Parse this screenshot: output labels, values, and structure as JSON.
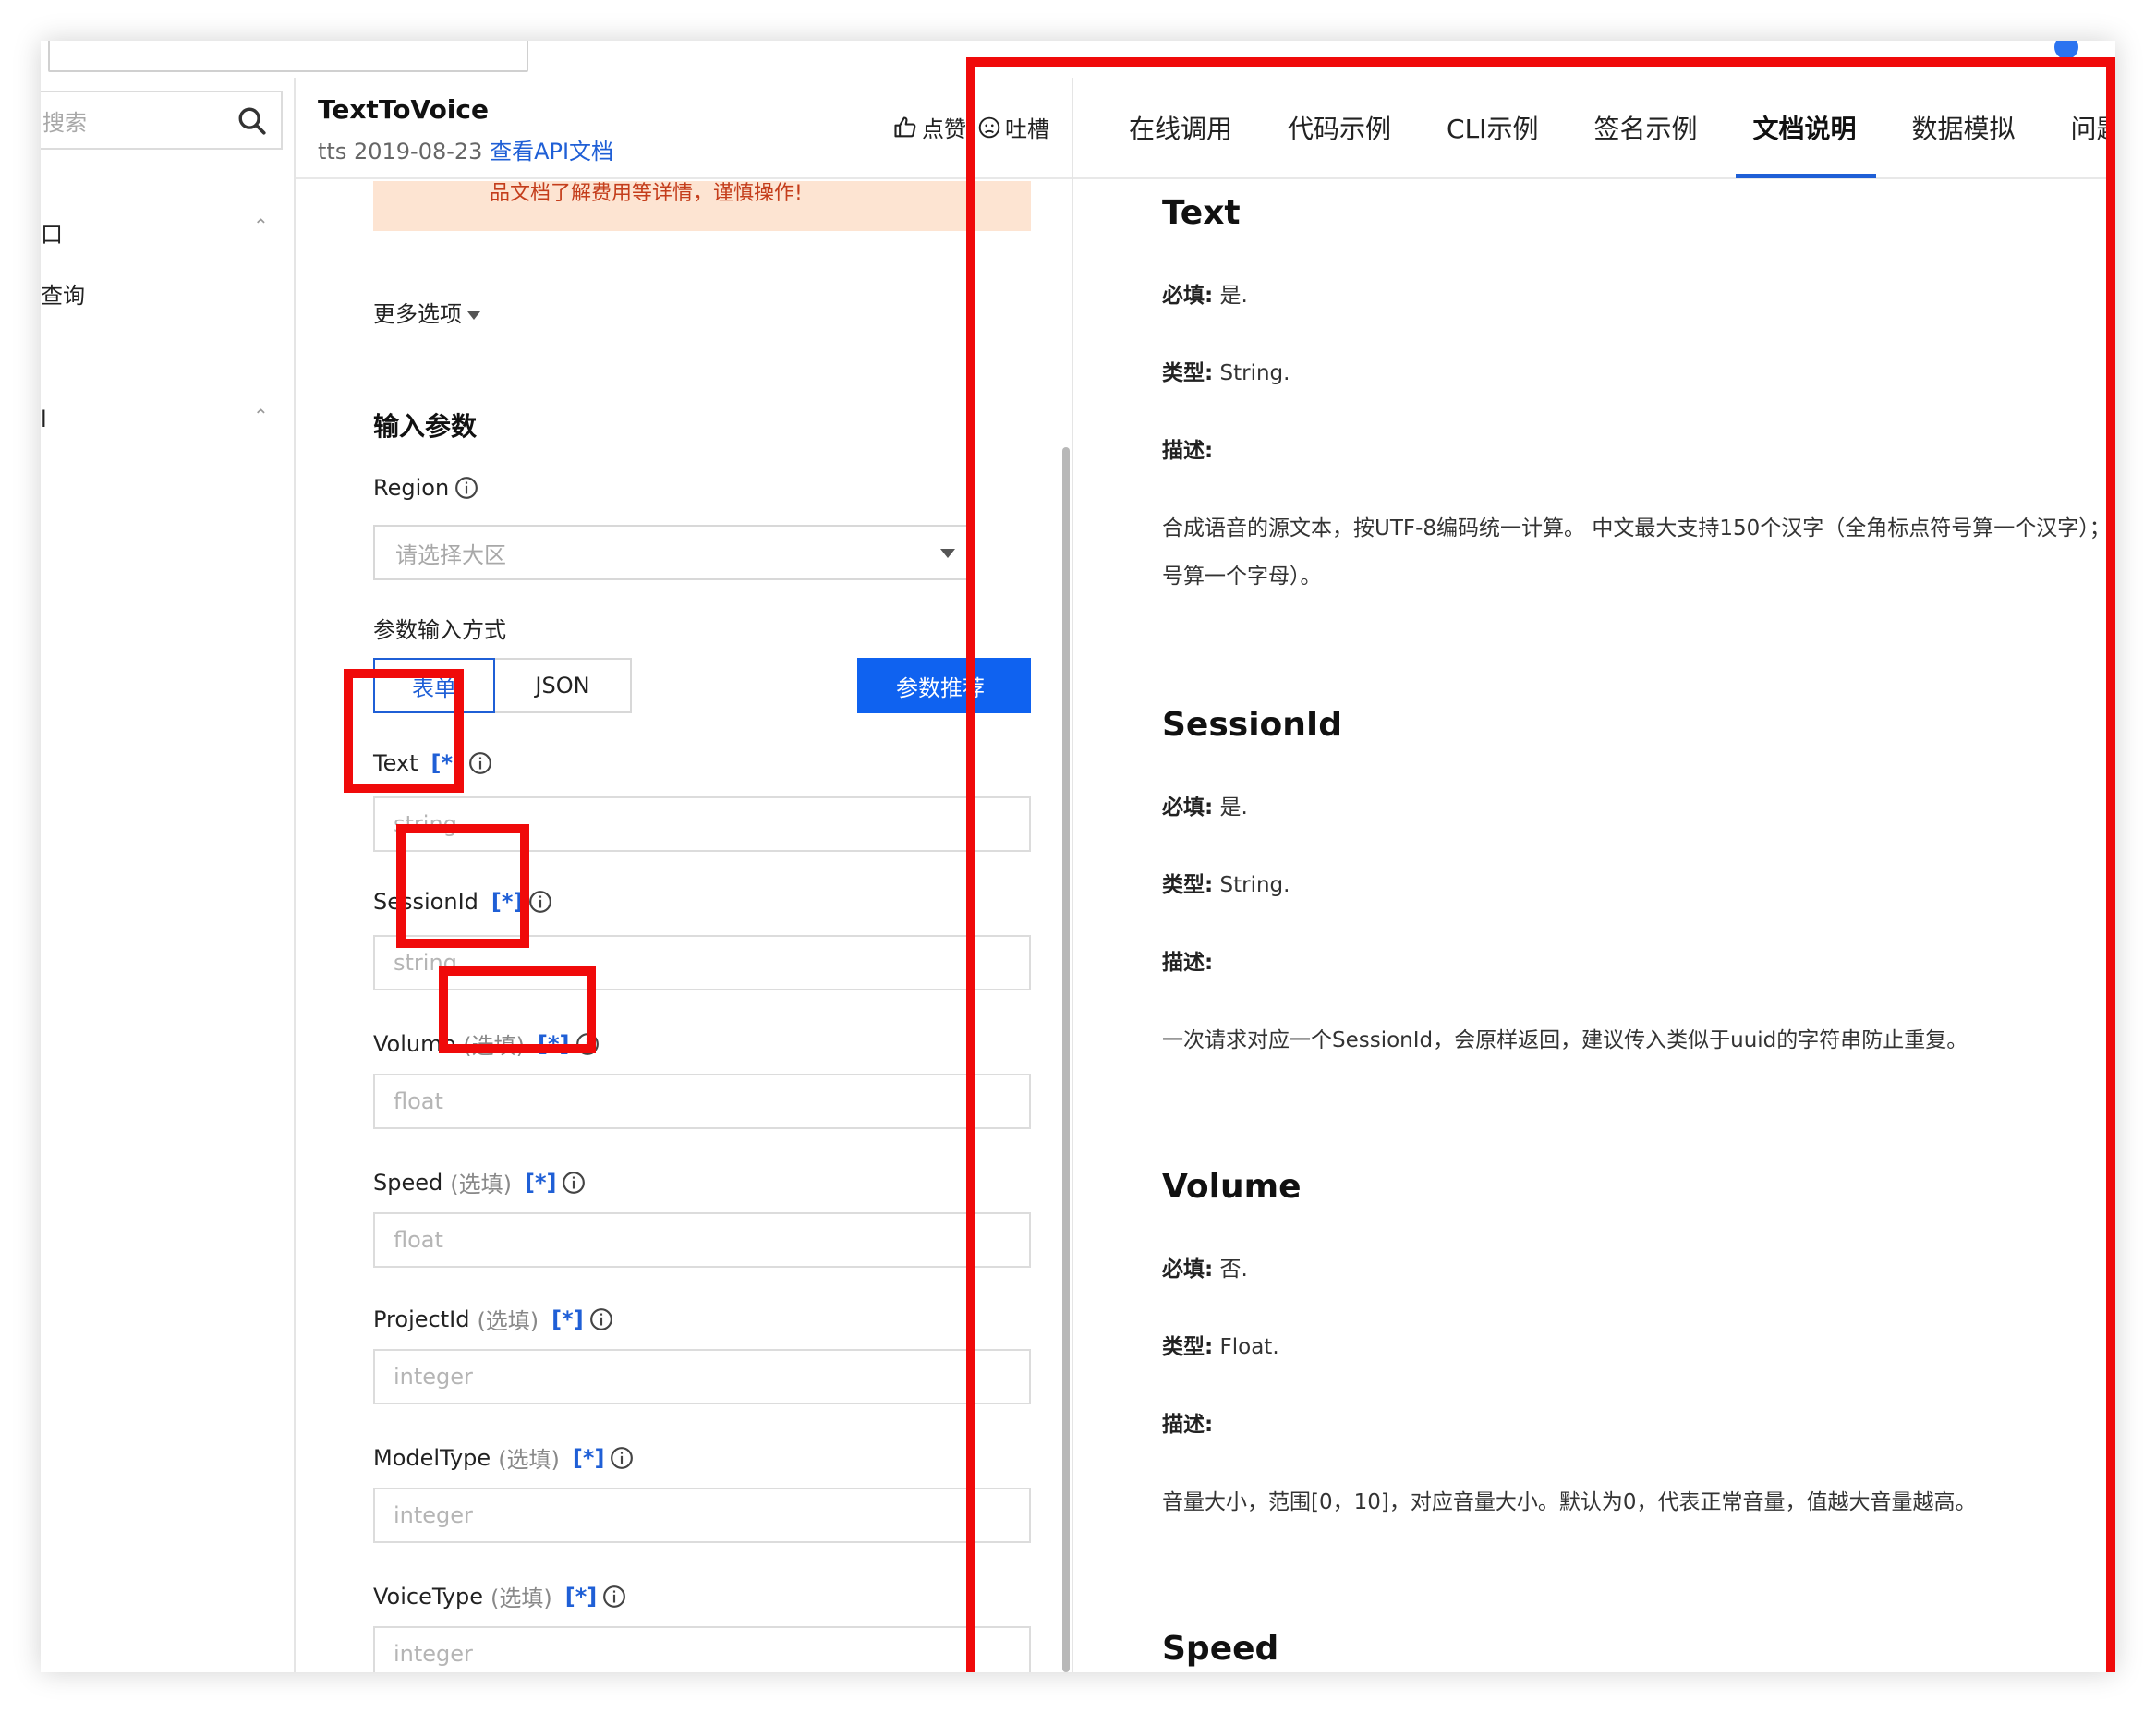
{
  "header": {
    "api_name": "TextToVoice",
    "api_meta": "tts 2019-08-23",
    "api_doc_link": "查看API文档",
    "like_label": "点赞",
    "complain_label": "吐槽"
  },
  "sidebar": {
    "search_placeholder": "搜索",
    "items": [
      {
        "label": "口"
      },
      {
        "label": "查询"
      },
      {
        "label": "l"
      }
    ]
  },
  "form": {
    "warning_text": "品文档了解费用等详情，谨慎操作!",
    "more_options": "更多选项",
    "section_title": "输入参数",
    "region_label": "Region",
    "region_placeholder": "请选择大区",
    "mode_label": "参数输入方式",
    "mode_form": "表单",
    "mode_json": "JSON",
    "recommend_button": "参数推荐",
    "star_mark": "[*]",
    "optional_mark": "(选填)",
    "fields": [
      {
        "label": "Text",
        "placeholder": "string"
      },
      {
        "label": "SessionId",
        "placeholder": "string"
      },
      {
        "label": "Volume",
        "placeholder": "float"
      },
      {
        "label": "Speed",
        "placeholder": "float"
      },
      {
        "label": "ProjectId",
        "placeholder": "integer"
      },
      {
        "label": "ModelType",
        "placeholder": "integer"
      },
      {
        "label": "VoiceType",
        "placeholder": "integer"
      }
    ]
  },
  "tabs": [
    "在线调用",
    "代码示例",
    "CLI示例",
    "签名示例",
    "文档说明",
    "数据模拟",
    "问题反"
  ],
  "active_tab": "文档说明",
  "docs": {
    "required_label": "必填:",
    "type_label": "类型:",
    "desc_label": "描述:",
    "params": [
      {
        "name": "Text",
        "required": "是.",
        "type": "String.",
        "desc_line1": "合成语音的源文本，按UTF-8编码统一计算。 中文最大支持150个汉字（全角标点符号算一个汉字）；英",
        "desc_line2": "号算一个字母）。"
      },
      {
        "name": "SessionId",
        "required": "是.",
        "type": "String.",
        "desc_line1": "一次请求对应一个SessionId，会原样返回，建议传入类似于uuid的字符串防止重复。"
      },
      {
        "name": "Volume",
        "required": "否.",
        "type": "Float.",
        "desc_line1": "音量大小，范围[0，10]，对应音量大小。默认为0，代表正常音量，值越大音量越高。"
      },
      {
        "name": "Speed"
      }
    ]
  },
  "colors": {
    "accent": "#1f5fd6",
    "primary_button": "#0f62f0",
    "warning_bg": "#fde4d2",
    "annotation_red": "#f00a0a"
  }
}
